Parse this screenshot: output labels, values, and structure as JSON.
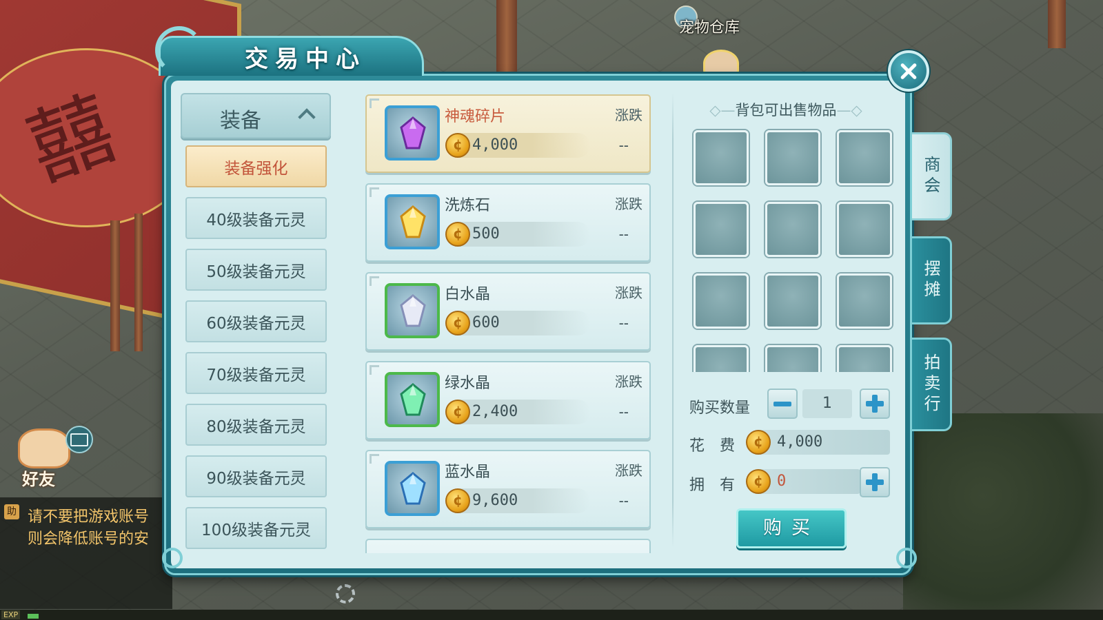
{
  "window": {
    "title": "交易中心"
  },
  "world": {
    "location_label": "宠物仓库",
    "friends_label": "好友",
    "chat_badge": "助",
    "chat_lines": [
      "请不要把游戏账号",
      "则会降低账号的安"
    ],
    "exp_label": "EXP",
    "exp_progress": 0.01
  },
  "categories": {
    "header": "装备",
    "items": [
      {
        "label": "装备强化",
        "active": true
      },
      {
        "label": "40级装备元灵",
        "active": false
      },
      {
        "label": "50级装备元灵",
        "active": false
      },
      {
        "label": "60级装备元灵",
        "active": false
      },
      {
        "label": "70级装备元灵",
        "active": false
      },
      {
        "label": "80级装备元灵",
        "active": false
      },
      {
        "label": "90级装备元灵",
        "active": false
      },
      {
        "label": "100级装备元灵",
        "active": false
      }
    ]
  },
  "list": {
    "trend_header": "涨跌",
    "items": [
      {
        "name": "神魂碎片",
        "price": "4,000",
        "trend": "--",
        "icon": "purple-soul-icon",
        "selected": true,
        "frame": "blue"
      },
      {
        "name": "洗炼石",
        "price": "500",
        "trend": "--",
        "icon": "gold-crystal-icon",
        "selected": false,
        "frame": "blue"
      },
      {
        "name": "白水晶",
        "price": "600",
        "trend": "--",
        "icon": "white-crystal-icon",
        "selected": false,
        "frame": "green"
      },
      {
        "name": "绿水晶",
        "price": "2,400",
        "trend": "--",
        "icon": "green-crystal-icon",
        "selected": false,
        "frame": "green"
      },
      {
        "name": "蓝水晶",
        "price": "9,600",
        "trend": "--",
        "icon": "blue-crystal-icon",
        "selected": false,
        "frame": "blue"
      }
    ]
  },
  "bag": {
    "title": "背包可出售物品",
    "slots_visible": 12
  },
  "purchase": {
    "quantity_label": "购买数量",
    "quantity": "1",
    "cost_label": "花　费",
    "cost": "4,000",
    "own_label": "拥　有",
    "own": "0",
    "buy_label": "购买"
  },
  "side_tabs": [
    {
      "label": "商会",
      "active": true
    },
    {
      "label": "摆摊",
      "active": false
    },
    {
      "label": "拍卖行",
      "active": false
    }
  ],
  "colors": {
    "panel": "#1d6f7e",
    "panel_inner": "#d8eef0",
    "active_category": "#f0d8a6",
    "selected_name": "#c85c3e",
    "own_value": "#c2543a",
    "button": "#1f9aa3"
  }
}
